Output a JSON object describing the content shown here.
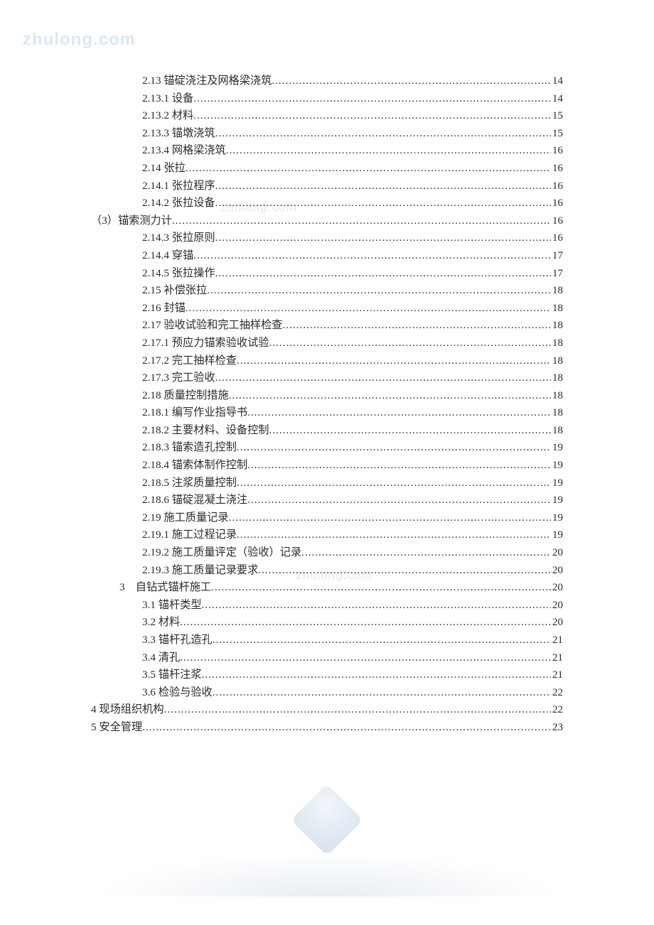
{
  "watermark": "zhulong.com",
  "wm_mid": "zhulong.com",
  "toc": [
    {
      "indent": 2,
      "label": "2.13 锚碇浇注及网格梁浇筑",
      "page": "14"
    },
    {
      "indent": 2,
      "label": "2.13.1 设备",
      "page": "14"
    },
    {
      "indent": 2,
      "label": "2.13.2 材料",
      "page": "15"
    },
    {
      "indent": 2,
      "label": "2.13.3 锚墩浇筑",
      "page": "15"
    },
    {
      "indent": 2,
      "label": "2.13.4 网格梁浇筑",
      "page": "16"
    },
    {
      "indent": 2,
      "label": "2.14 张拉",
      "page": "16"
    },
    {
      "indent": 2,
      "label": "2.14.1 张拉程序",
      "page": "16"
    },
    {
      "indent": 2,
      "label": "2.14.2 张拉设备",
      "page": "16"
    },
    {
      "indent": 0,
      "label": "（3）锚索测力计",
      "page": "16"
    },
    {
      "indent": 2,
      "label": "2.14.3 张拉原则",
      "page": "16"
    },
    {
      "indent": 2,
      "label": "2.14.4 穿锚",
      "page": "17"
    },
    {
      "indent": 2,
      "label": "2.14.5 张拉操作",
      "page": "17"
    },
    {
      "indent": 2,
      "label": "2.15 补偿张拉",
      "page": "18"
    },
    {
      "indent": 2,
      "label": "2.16 封锚",
      "page": "18"
    },
    {
      "indent": 2,
      "label": "2.17 验收试验和完工抽样检查",
      "page": "18"
    },
    {
      "indent": 2,
      "label": "2.17.1 预应力锚索验收试验",
      "page": "18"
    },
    {
      "indent": 2,
      "label": "2.17.2 完工抽样检查",
      "page": "18"
    },
    {
      "indent": 2,
      "label": "2.17.3 完工验收",
      "page": "18"
    },
    {
      "indent": 2,
      "label": "2.18 质量控制措施",
      "page": "18"
    },
    {
      "indent": 2,
      "label": "2.18.1 编写作业指导书",
      "page": "18"
    },
    {
      "indent": 2,
      "label": "2.18.2 主要材料、设备控制",
      "page": "18"
    },
    {
      "indent": 2,
      "label": "2.18.3 锚索造孔控制",
      "page": "19"
    },
    {
      "indent": 2,
      "label": "2.18.4  锚索体制作控制",
      "page": "19"
    },
    {
      "indent": 2,
      "label": "2.18.5  注浆质量控制",
      "page": "19"
    },
    {
      "indent": 2,
      "label": "2.18.6 锚碇混凝土浇注",
      "page": "19"
    },
    {
      "indent": 2,
      "label": "2.19 施工质量记录",
      "page": "19"
    },
    {
      "indent": 2,
      "label": "2.19.1 施工过程记录",
      "page": "19"
    },
    {
      "indent": 2,
      "label": "2.19.2 施工质量评定（验收）记录",
      "page": "20"
    },
    {
      "indent": 2,
      "label": "2.19.3 施工质量记录要求",
      "page": "20"
    },
    {
      "indent": 1,
      "label": "3　自钻式锚杆施工",
      "page": "20"
    },
    {
      "indent": 2,
      "label": "3.1 锚杆类型",
      "page": "20"
    },
    {
      "indent": 2,
      "label": "3.2 材料",
      "page": "20"
    },
    {
      "indent": 2,
      "label": "3.3 锚杆孔造孔",
      "page": "21"
    },
    {
      "indent": 2,
      "label": "3.4 清孔",
      "page": "21"
    },
    {
      "indent": 2,
      "label": "3.5 锚杆注浆",
      "page": "21"
    },
    {
      "indent": 2,
      "label": "3.6 检验与验收",
      "page": "22"
    },
    {
      "indent": 0,
      "label": "4 现场组织机构",
      "page": "22"
    },
    {
      "indent": 0,
      "label": "5 安全管理",
      "page": "23"
    }
  ]
}
